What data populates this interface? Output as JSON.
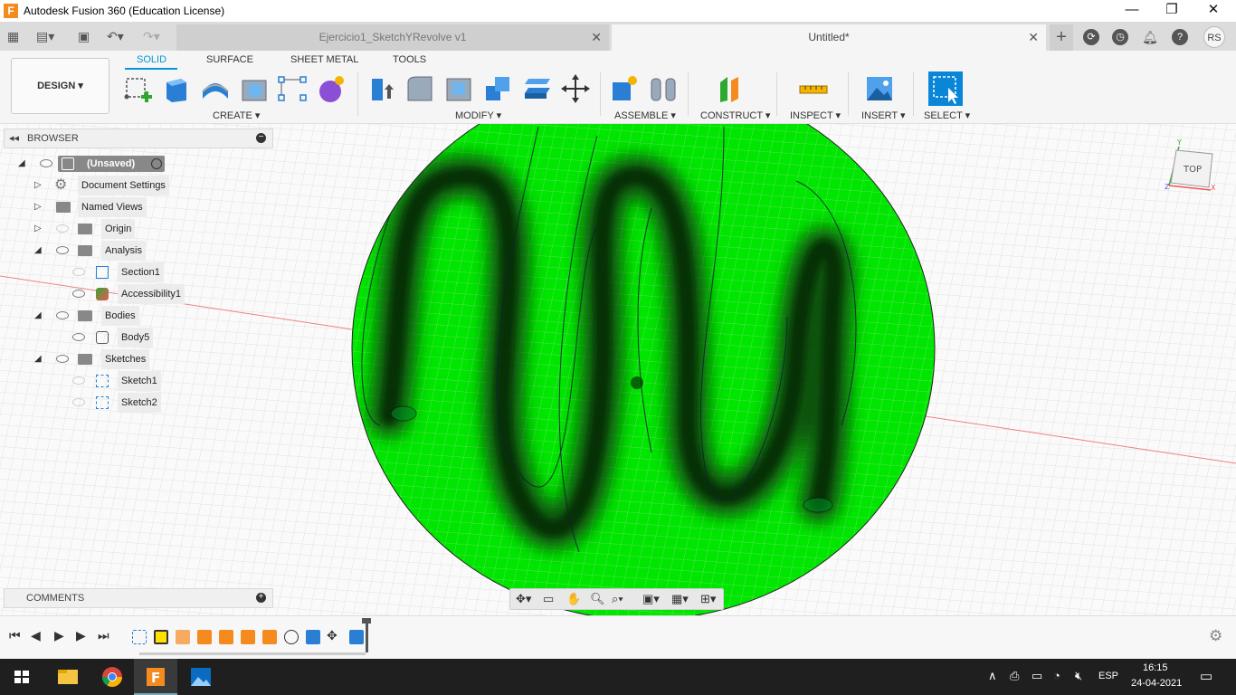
{
  "app": {
    "title": "Autodesk Fusion 360 (Education License)",
    "logo_letter": "F"
  },
  "window_controls": {
    "minimize": "—",
    "maximize": "❐",
    "close": "✕"
  },
  "tabs": [
    {
      "label": "Ejercicio1_SketchYRevolve v1",
      "close": "✕"
    },
    {
      "label": "Untitled*",
      "close": "✕"
    }
  ],
  "header_icons": {
    "add": "+",
    "user_initials": "RS"
  },
  "ribbon": {
    "workspace": "DESIGN ▾",
    "tabs": [
      "SOLID",
      "SURFACE",
      "SHEET METAL",
      "TOOLS"
    ],
    "groups": [
      "CREATE ▾",
      "MODIFY ▾",
      "ASSEMBLE ▾",
      "CONSTRUCT ▾",
      "INSPECT ▾",
      "INSERT ▾",
      "SELECT ▾"
    ]
  },
  "browser": {
    "title": "BROWSER",
    "items": [
      {
        "label": "(Unsaved)"
      },
      {
        "label": "Document Settings"
      },
      {
        "label": "Named Views"
      },
      {
        "label": "Origin"
      },
      {
        "label": "Analysis"
      },
      {
        "label": "Section1"
      },
      {
        "label": "Accessibility1"
      },
      {
        "label": "Bodies"
      },
      {
        "label": "Body5"
      },
      {
        "label": "Sketches"
      },
      {
        "label": "Sketch1"
      },
      {
        "label": "Sketch2"
      }
    ]
  },
  "comments": {
    "title": "COMMENTS"
  },
  "viewcube": {
    "face": "TOP",
    "axis_x": "X",
    "axis_y": "Y",
    "axis_z": "Z"
  },
  "taskbar": {
    "lang": "ESP",
    "time": "16:15",
    "date": "24-04-2021"
  },
  "colors": {
    "accent": "#0696d7",
    "model": "#00e600",
    "taskbar": "#1f1f1f"
  }
}
